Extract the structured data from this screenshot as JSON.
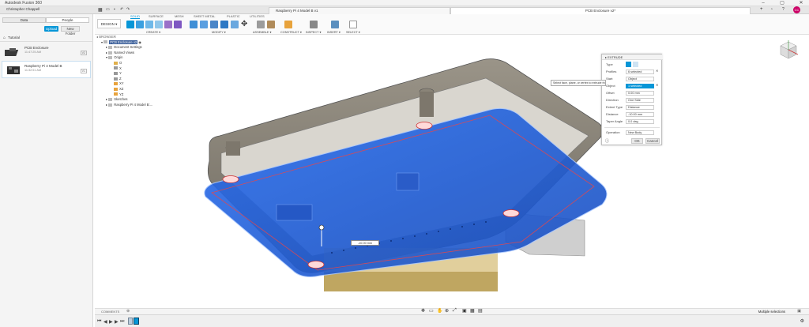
{
  "window": {
    "title": "Autodesk Fusion 360"
  },
  "tabs": [
    {
      "label": "Raspberry Pi 4 Model B v1"
    },
    {
      "label": "PCB Enclosure v2*"
    }
  ],
  "user": {
    "name": "Christopher Chappell"
  },
  "data_panel": {
    "segments": [
      "Data",
      "People"
    ],
    "upload_label": "Upload",
    "new_folder_label": "New Folder",
    "project": "Tutorial",
    "files": [
      {
        "name": "PCB Enclosure",
        "date": "11:47:25 AM",
        "version": "V2"
      },
      {
        "name": "Raspberry Pi 4 Model B",
        "date": "11:32:51 AM",
        "version": "V1"
      }
    ]
  },
  "toolbar": {
    "design_label": "DESIGN",
    "workspace_tabs": [
      "SOLID",
      "SURFACE",
      "MESH",
      "SHEET METAL",
      "PLASTIC",
      "UTILITIES"
    ],
    "groups": [
      "CREATE",
      "MODIFY",
      "ASSEMBLE",
      "CONSTRUCT",
      "INSPECT",
      "INSERT",
      "SELECT"
    ]
  },
  "browser": {
    "header": "BROWSER",
    "root": "PCB Enclosure v2",
    "nodes": [
      "Document Settings",
      "Named Views",
      "Origin",
      "O",
      "X",
      "Y",
      "Z",
      "XY",
      "XZ",
      "YZ",
      "Sketches",
      "Raspberry Pi 4 Model B:..."
    ]
  },
  "extrude_dialog": {
    "title": "EXTRUDE",
    "rows": [
      {
        "label": "Type",
        "value": ""
      },
      {
        "label": "Profiles",
        "value": "6 selected"
      },
      {
        "label": "Start",
        "value": "Object"
      },
      {
        "label": "Object",
        "value": "1 selected"
      },
      {
        "label": "Offset",
        "value": "0.00 mm"
      },
      {
        "label": "Direction",
        "value": "One Side"
      },
      {
        "label": "Extent Type",
        "value": "Distance"
      },
      {
        "label": "Distance",
        "value": "-10.00 mm"
      },
      {
        "label": "Taper Angle",
        "value": "0.0 deg"
      },
      {
        "label": "Operation",
        "value": "New Body"
      }
    ],
    "ok_label": "OK",
    "cancel_label": "Cancel",
    "tooltip": "Select face, plane, or vertex to extrude from"
  },
  "viewport": {
    "distance_readout": "-10.00 mm"
  },
  "comments": {
    "label": "COMMENTS"
  },
  "status": {
    "selection": "Multiple selections"
  },
  "colors": {
    "accent": "#0696d7",
    "selection_blue": "#1e5fd8",
    "enclosure": "#8a8478"
  }
}
